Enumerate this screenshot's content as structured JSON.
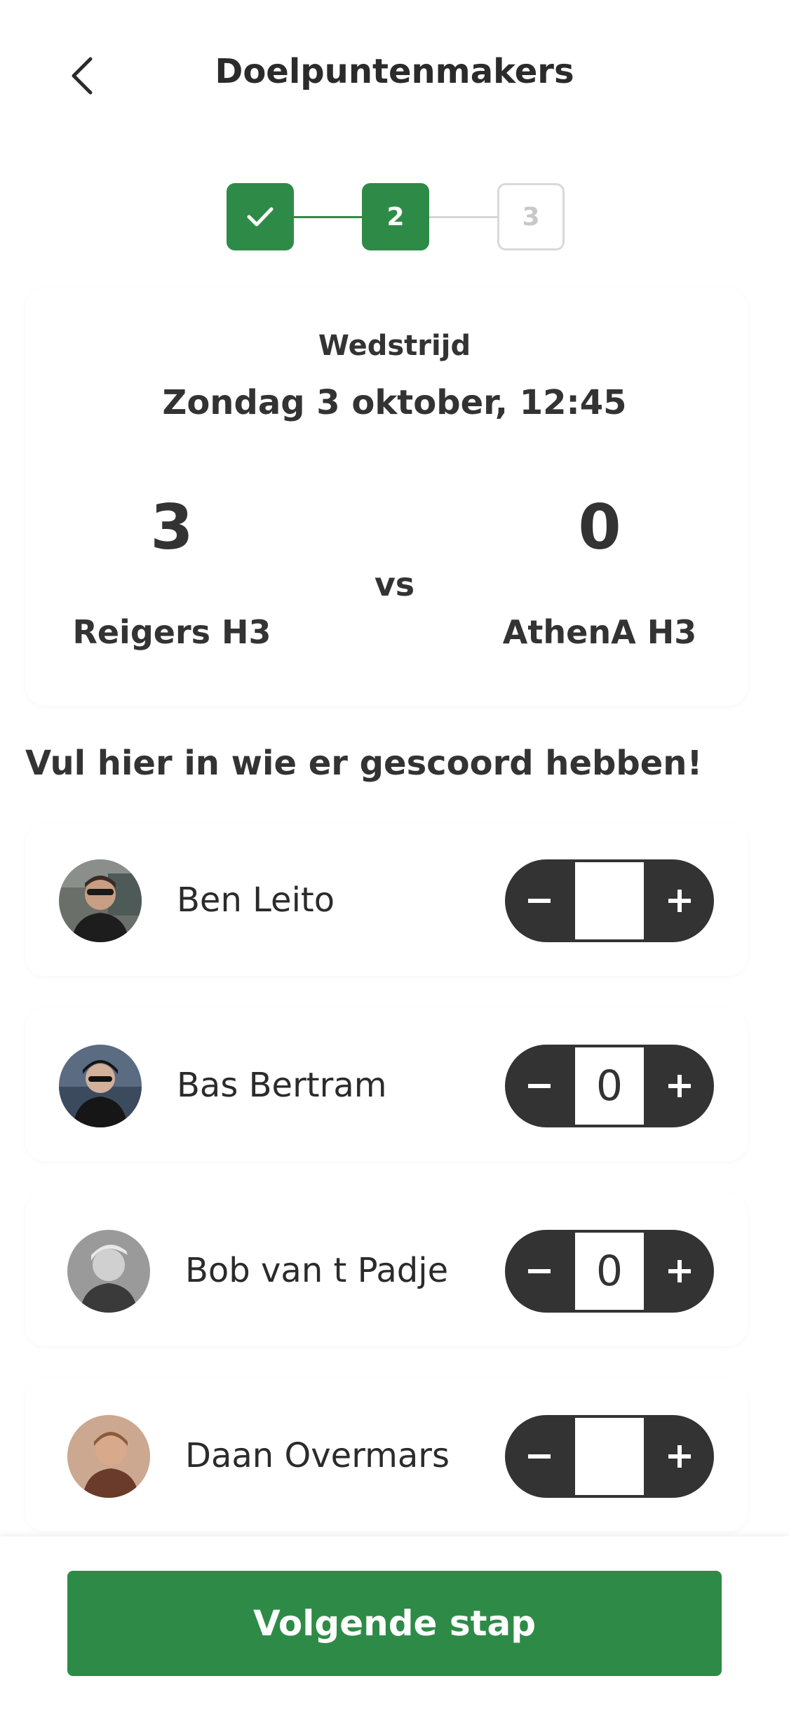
{
  "header": {
    "title": "Doelpuntenmakers",
    "back_icon": "chevron-left-icon"
  },
  "stepper": {
    "steps": [
      {
        "label": "",
        "state": "done",
        "icon": "check-icon"
      },
      {
        "label": "2",
        "state": "active"
      },
      {
        "label": "3",
        "state": "inactive"
      }
    ]
  },
  "match": {
    "label": "Wedstrijd",
    "date": "Zondag 3 oktober, 12:45",
    "home_score": "3",
    "away_score": "0",
    "vs": "vs",
    "home_team": "Reigers H3",
    "away_team": "AthenA H3"
  },
  "instruction": "Vul hier in wie er gescoord hebben!",
  "players": [
    {
      "name": "Ben Leito",
      "count": ""
    },
    {
      "name": "Bas Bertram",
      "count": "0"
    },
    {
      "name": "Bob van t Padje",
      "count": "0"
    },
    {
      "name": "Daan Overmars",
      "count": ""
    }
  ],
  "footer": {
    "next_label": "Volgende stap"
  },
  "colors": {
    "primary": "#2e8b47",
    "control": "#333333"
  }
}
